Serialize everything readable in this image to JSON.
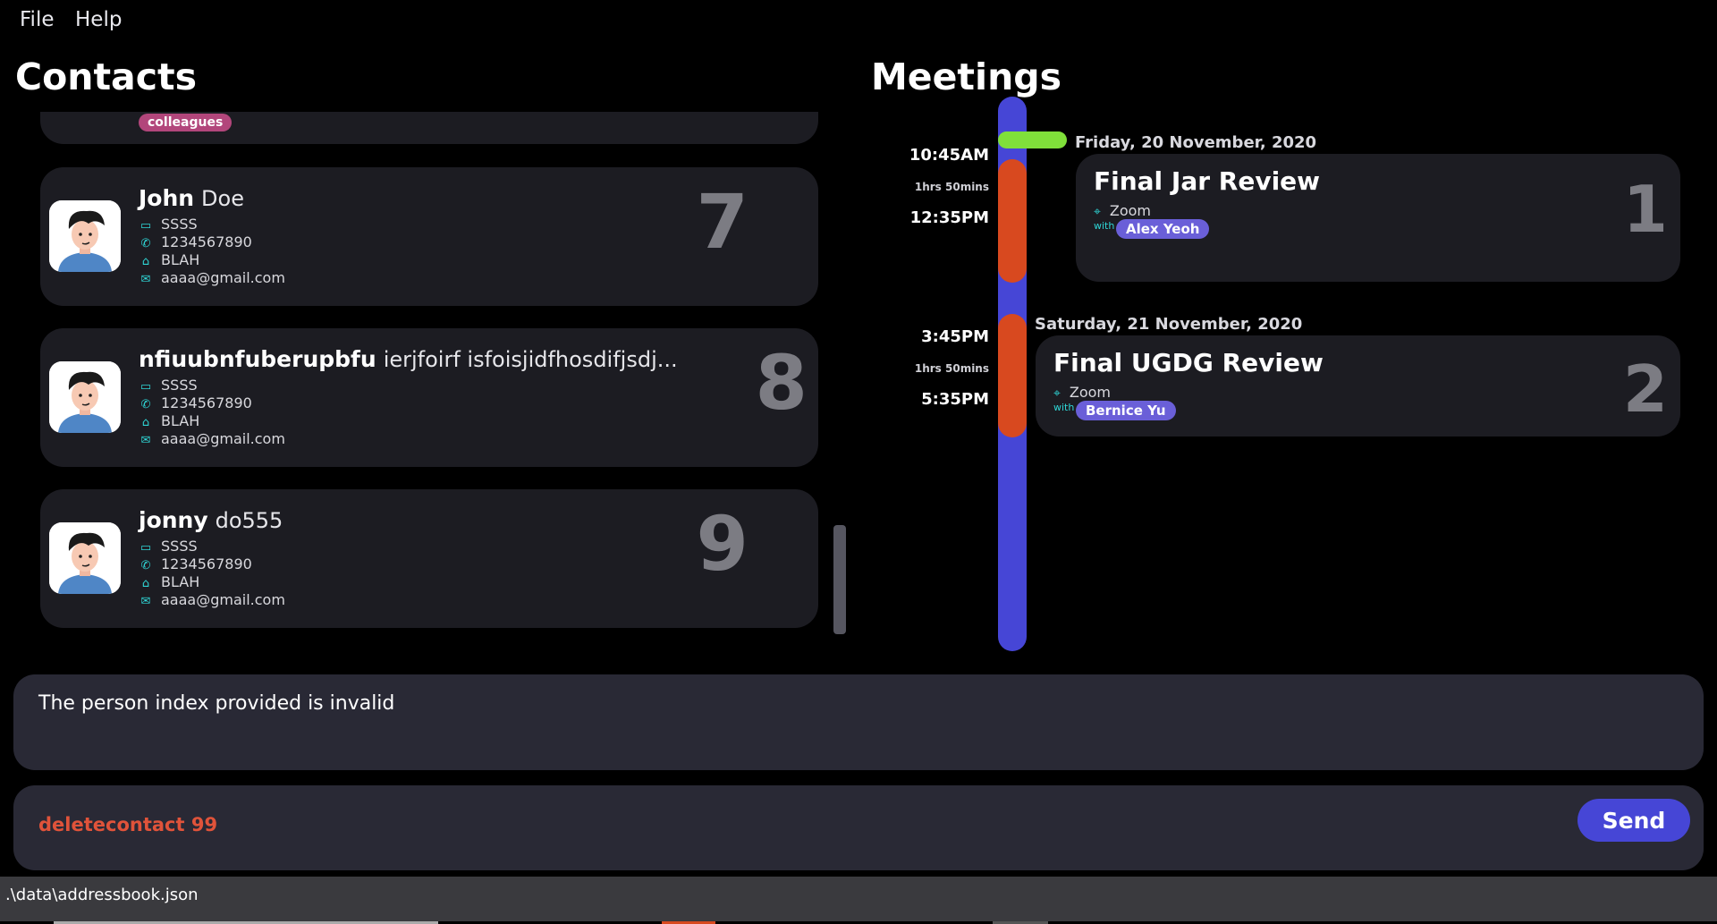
{
  "menu": {
    "file": "File",
    "help": "Help"
  },
  "contacts": {
    "title": "Contacts",
    "partial_tag": "colleagues",
    "items": [
      {
        "first": "John",
        "last": "Doe",
        "company": "SSSS",
        "phone": "1234567890",
        "address": "BLAH",
        "email": "aaaa@gmail.com",
        "index": "7"
      },
      {
        "first": "nfiuubnfuberupbfu",
        "last": "ierjfoirf isfoisjidfhosdifjsdj...",
        "company": "SSSS",
        "phone": "1234567890",
        "address": "BLAH",
        "email": "aaaa@gmail.com",
        "index": "8"
      },
      {
        "first": "jonny",
        "last": "do555",
        "company": "SSSS",
        "phone": "1234567890",
        "address": "BLAH",
        "email": "aaaa@gmail.com",
        "index": "9"
      }
    ]
  },
  "meetings": {
    "title": "Meetings",
    "items": [
      {
        "date": "Friday, 20 November, 2020",
        "start": "10:45AM",
        "duration": "1hrs 50mins",
        "end": "12:35PM",
        "title": "Final Jar Review",
        "location": "Zoom",
        "with_label": "with",
        "person": "Alex Yeoh",
        "index": "1"
      },
      {
        "date": "Saturday, 21 November, 2020",
        "start": "3:45PM",
        "duration": "1hrs 50mins",
        "end": "5:35PM",
        "title": "Final UGDG Review",
        "location": "Zoom",
        "with_label": "with",
        "person": "Bernice Yu",
        "index": "2"
      }
    ]
  },
  "result": {
    "text": "The person index provided is invalid"
  },
  "command": {
    "value": "deletecontact 99",
    "send_label": "Send"
  },
  "status": {
    "path": ".\\data\\addressbook.json"
  },
  "colors": {
    "timeline": "#4646d6",
    "slot": "#d8491f",
    "now_marker": "#80e03a",
    "tag": "#b2467b",
    "person_chip": "#6a5fd8",
    "command_text": "#e0533a"
  },
  "icons": {
    "company": "briefcase-icon",
    "phone": "phone-icon",
    "address": "home-icon",
    "email": "mail-icon",
    "location": "location-pin-icon"
  }
}
